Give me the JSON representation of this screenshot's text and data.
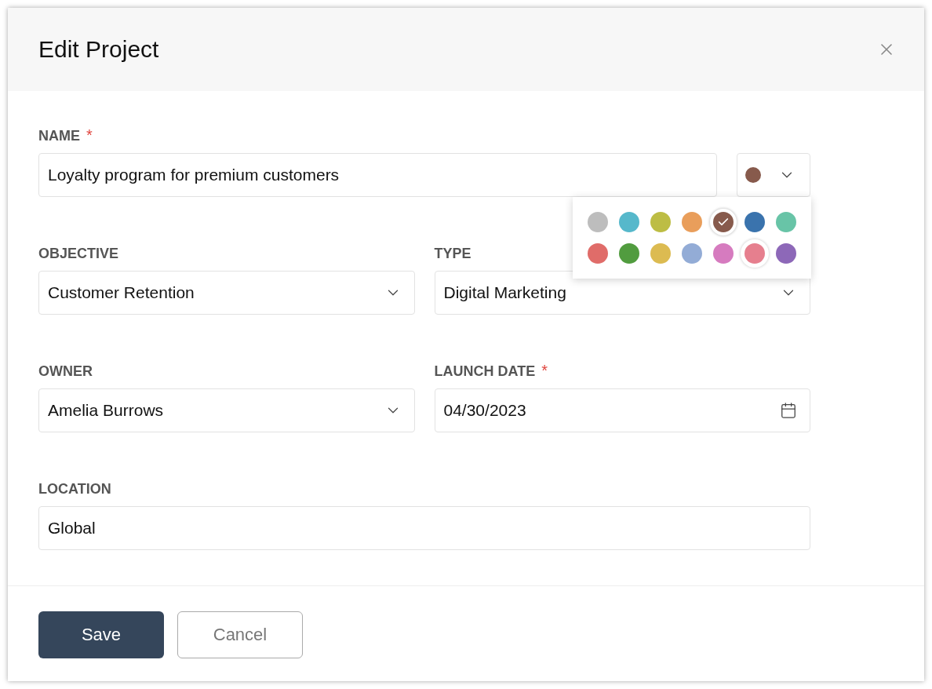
{
  "dialog": {
    "title": "Edit Project"
  },
  "rows": [
    [
      {
        "kind": "text",
        "label": "NAME",
        "required_mark": "*",
        "value": "Loyalty program for premium customers"
      }
    ],
    [
      {
        "kind": "select",
        "label": "OBJECTIVE",
        "value": "Customer Retention"
      },
      {
        "kind": "select",
        "label": "TYPE",
        "value": "Digital Marketing"
      }
    ],
    [
      {
        "kind": "select",
        "label": "OWNER",
        "value": "Amelia Burrows"
      },
      {
        "kind": "date",
        "label": "LAUNCH DATE",
        "required_mark": "*",
        "value": "04/30/2023"
      }
    ],
    [
      {
        "kind": "text",
        "label": "LOCATION",
        "value": "Global"
      }
    ]
  ],
  "color_picker": {
    "expanded": true,
    "swatches": [
      {
        "color": "#bdbdbd",
        "selected": false,
        "highlighted": false
      },
      {
        "color": "#56b8cb",
        "selected": false,
        "highlighted": false
      },
      {
        "color": "#bdbd44",
        "selected": false,
        "highlighted": false
      },
      {
        "color": "#e99e5b",
        "selected": false,
        "highlighted": false
      },
      {
        "color": "#875a4c",
        "selected": true,
        "highlighted": false
      },
      {
        "color": "#3a73ad",
        "selected": false,
        "highlighted": false
      },
      {
        "color": "#68c4a7",
        "selected": false,
        "highlighted": false
      },
      {
        "color": "#e06c69",
        "selected": false,
        "highlighted": false
      },
      {
        "color": "#519c3f",
        "selected": false,
        "highlighted": false
      },
      {
        "color": "#dcbb51",
        "selected": false,
        "highlighted": false
      },
      {
        "color": "#93acd6",
        "selected": false,
        "highlighted": false
      },
      {
        "color": "#d67bbf",
        "selected": false,
        "highlighted": false
      },
      {
        "color": "#e67f8e",
        "selected": false,
        "highlighted": true
      },
      {
        "color": "#8d68b8",
        "selected": false,
        "highlighted": false
      }
    ]
  },
  "buttons": [
    {
      "kind": "primary",
      "label": "Save"
    },
    {
      "kind": "secondary",
      "label": "Cancel"
    }
  ]
}
